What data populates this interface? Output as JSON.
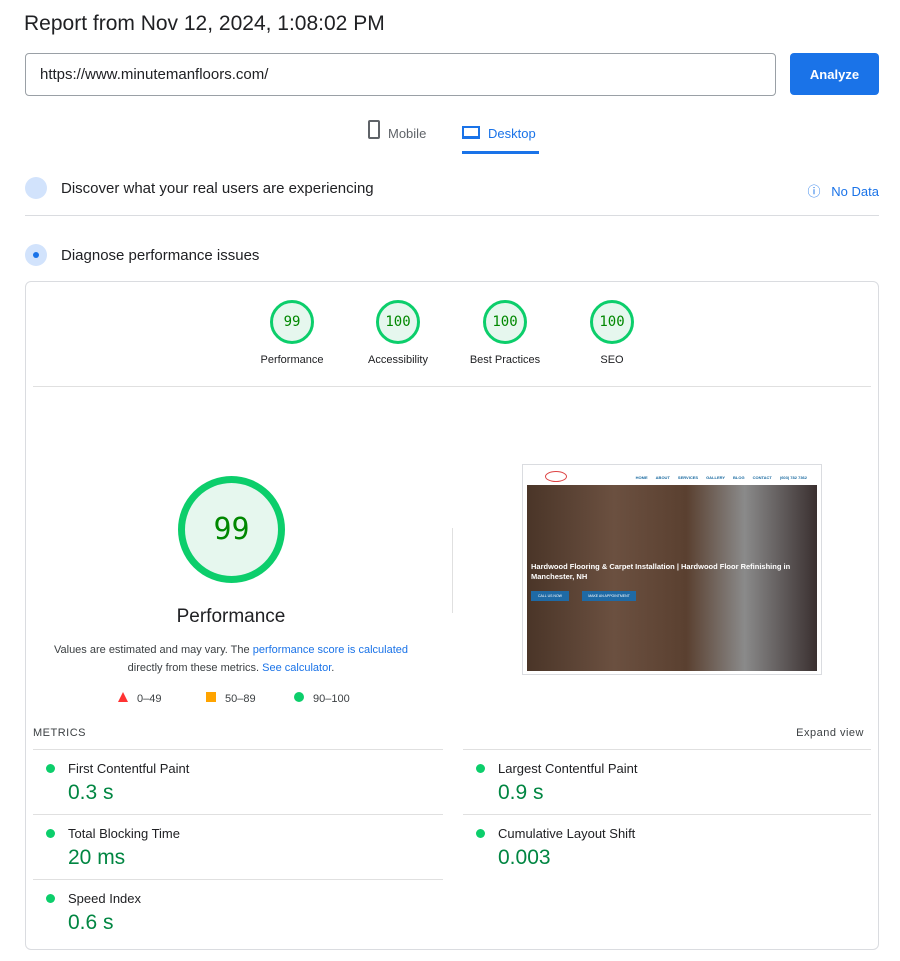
{
  "title": "Report from Nov 12, 2024, 1:08:02 PM",
  "url_input": "https://www.minutemanfloors.com/",
  "analyze_label": "Analyze",
  "tabs": [
    {
      "label": "Mobile",
      "active": false
    },
    {
      "label": "Desktop",
      "active": true
    }
  ],
  "crux": {
    "title": "Discover what your real users are experiencing",
    "status": "No Data"
  },
  "diagnose": {
    "title": "Diagnose performance issues"
  },
  "categories": [
    {
      "label": "Performance",
      "score": "99"
    },
    {
      "label": "Accessibility",
      "score": "100"
    },
    {
      "label": "Best Practices",
      "score": "100"
    },
    {
      "label": "SEO",
      "score": "100"
    }
  ],
  "main_score": {
    "score": "99",
    "label": "Performance",
    "note_pre": "Values are estimated and may vary. The ",
    "note_link1": "performance score is calculated",
    "note_mid": " directly from these metrics. ",
    "note_link2": "See calculator",
    "note_end": "."
  },
  "legend": [
    {
      "range": "0–49",
      "color": "#ff3333"
    },
    {
      "range": "50–89",
      "color": "#ffa400"
    },
    {
      "range": "90–100",
      "color": "#0cce6b"
    }
  ],
  "metrics_label": "METRICS",
  "expand_label": "Expand view",
  "metrics": [
    {
      "name": "First Contentful Paint",
      "value": "0.3 s"
    },
    {
      "name": "Largest Contentful Paint",
      "value": "0.9 s"
    },
    {
      "name": "Total Blocking Time",
      "value": "20 ms"
    },
    {
      "name": "Cumulative Layout Shift",
      "value": "0.003"
    },
    {
      "name": "Speed Index",
      "value": "0.6 s"
    }
  ],
  "screenshot": {
    "nav": [
      "HOME",
      "ABOUT",
      "SERVICES",
      "GALLERY",
      "BLOG",
      "CONTACT",
      "(603) 782 7362"
    ],
    "headline": "Hardwood Flooring & Carpet Installation | Hardwood Floor Refinishing in Manchester, NH",
    "btn1": "CALL US NOW",
    "btn2": "MAKE AN APPOINTMENT"
  }
}
